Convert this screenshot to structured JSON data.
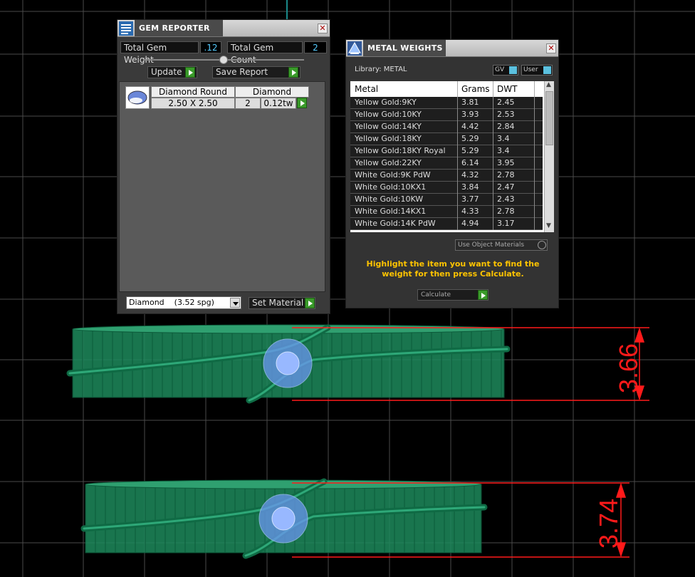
{
  "gem_reporter": {
    "title": "GEM REPORTER",
    "close_glyph": "✕",
    "total_weight_label": "Total Gem Weight",
    "total_weight_value": ".12",
    "total_count_label": "Total Gem Count",
    "total_count_value": "2",
    "update_label": "Update",
    "save_report_label": "Save Report",
    "row": {
      "header_shape": "Diamond Round",
      "header_material": "Diamond",
      "size": "2.50 X 2.50",
      "count": "2",
      "weight": "0.12tw"
    },
    "material_select": "Diamond    (3.52 spg)",
    "set_material_label": "Set Material"
  },
  "metal_weights": {
    "title": "METAL WEIGHTS",
    "close_glyph": "✕",
    "library_label": "Library: METAL",
    "gv_label": "GV",
    "user_label": "User",
    "columns": [
      "Metal",
      "Grams",
      "DWT"
    ],
    "rows": [
      {
        "metal": "Yellow Gold:9KY",
        "grams": "3.81",
        "dwt": "2.45"
      },
      {
        "metal": "Yellow Gold:10KY",
        "grams": "3.93",
        "dwt": "2.53"
      },
      {
        "metal": "Yellow Gold:14KY",
        "grams": "4.42",
        "dwt": "2.84"
      },
      {
        "metal": "Yellow Gold:18KY",
        "grams": "5.29",
        "dwt": "3.4"
      },
      {
        "metal": "Yellow Gold:18KY Royal",
        "grams": "5.29",
        "dwt": "3.4"
      },
      {
        "metal": "Yellow Gold:22KY",
        "grams": "6.14",
        "dwt": "3.95"
      },
      {
        "metal": "White Gold:9K PdW",
        "grams": "4.32",
        "dwt": "2.78"
      },
      {
        "metal": "White Gold:10KX1",
        "grams": "3.84",
        "dwt": "2.47"
      },
      {
        "metal": "White Gold:10KW",
        "grams": "3.77",
        "dwt": "2.43"
      },
      {
        "metal": "White Gold:14KX1",
        "grams": "4.33",
        "dwt": "2.78"
      },
      {
        "metal": "White Gold:14K PdW",
        "grams": "4.94",
        "dwt": "3.17"
      }
    ],
    "use_object_materials": "Use Object Materials",
    "instruction": "Highlight the item you want to find the weight for then press Calculate.",
    "calculate_label": "Calculate"
  },
  "viewport": {
    "dimension_top": "3.66",
    "dimension_bottom": "3.74",
    "colors": {
      "ring": "#1e8a5c",
      "ring_edge": "#0c5a3a",
      "gem": "#7aa8ff",
      "dimension": "#ff1a1a",
      "grid": "#5a5a5a"
    }
  }
}
